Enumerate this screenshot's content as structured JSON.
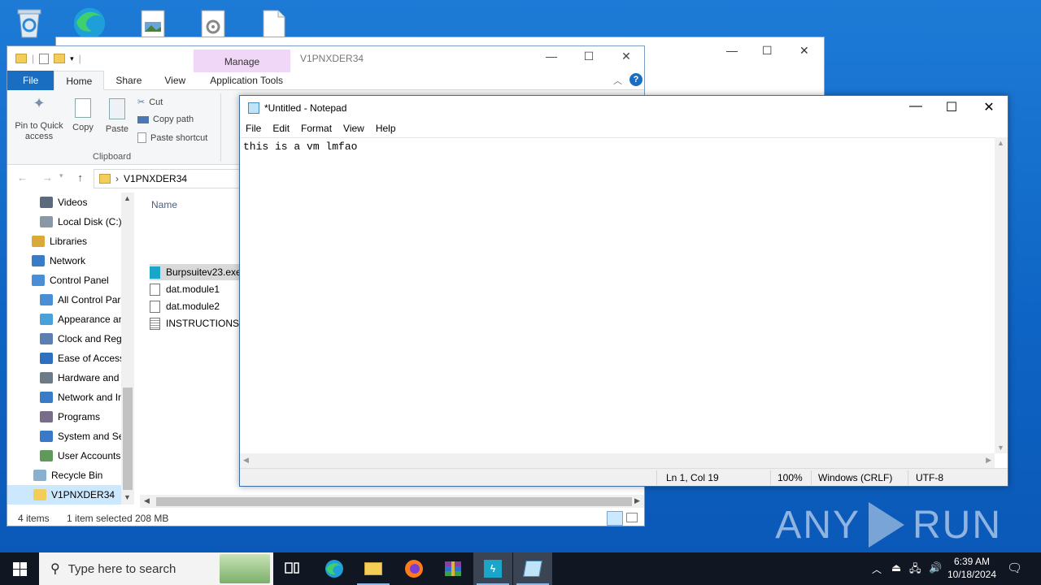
{
  "desktop": {
    "icons": [
      "recycle-bin-icon",
      "edge-icon",
      "image-file-icon",
      "settings-file-icon",
      "blank-file-icon"
    ]
  },
  "watermark": {
    "left": "ANY",
    "right": "RUN"
  },
  "explorer": {
    "title": "V1PNXDER34",
    "manage_tab": "Manage",
    "tabs": {
      "file": "File",
      "home": "Home",
      "share": "Share",
      "view": "View",
      "app_tools": "Application Tools"
    },
    "ribbon": {
      "pin": "Pin to Quick access",
      "copy": "Copy",
      "paste": "Paste",
      "cut": "Cut",
      "copy_path": "Copy path",
      "paste_shortcut": "Paste shortcut",
      "group_clipboard": "Clipboard"
    },
    "address": {
      "folder": "V1PNXDER34",
      "sep": "›"
    },
    "nav_items": [
      {
        "label": "Videos",
        "icon": "videos-icon"
      },
      {
        "label": "Local Disk (C:)",
        "icon": "drive-icon"
      },
      {
        "label": "Libraries",
        "icon": "libraries-icon"
      },
      {
        "label": "Network",
        "icon": "network-icon"
      },
      {
        "label": "Control Panel",
        "icon": "control-panel-icon"
      },
      {
        "label": "All Control Par",
        "icon": "control-panel-icon"
      },
      {
        "label": "Appearance an",
        "icon": "appearance-icon"
      },
      {
        "label": "Clock and Regi",
        "icon": "clock-icon"
      },
      {
        "label": "Ease of Access",
        "icon": "ease-of-access-icon"
      },
      {
        "label": "Hardware and",
        "icon": "hardware-icon"
      },
      {
        "label": "Network and Ir",
        "icon": "network-icon"
      },
      {
        "label": "Programs",
        "icon": "programs-icon"
      },
      {
        "label": "System and Se",
        "icon": "shield-icon"
      },
      {
        "label": "User Accounts",
        "icon": "users-icon"
      },
      {
        "label": "Recycle Bin",
        "icon": "recycle-bin-icon"
      },
      {
        "label": "V1PNXDER34",
        "icon": "folder-icon"
      }
    ],
    "column_name": "Name",
    "files": [
      {
        "name": "Burpsuitev23.exe",
        "selected": true
      },
      {
        "name": "dat.module1",
        "selected": false
      },
      {
        "name": "dat.module2",
        "selected": false
      },
      {
        "name": "INSTRUCTIONS R",
        "selected": false
      }
    ],
    "status": {
      "items": "4 items",
      "selected": "1 item selected",
      "size": "208 MB"
    }
  },
  "notepad": {
    "title": "*Untitled - Notepad",
    "menu": [
      "File",
      "Edit",
      "Format",
      "View",
      "Help"
    ],
    "content": "this is a vm lmfao",
    "status": {
      "position": "Ln 1, Col 19",
      "zoom": "100%",
      "line_ending": "Windows (CRLF)",
      "encoding": "UTF-8"
    }
  },
  "taskbar": {
    "search_placeholder": "Type here to search",
    "time": "6:39 AM",
    "date": "10/18/2024"
  }
}
